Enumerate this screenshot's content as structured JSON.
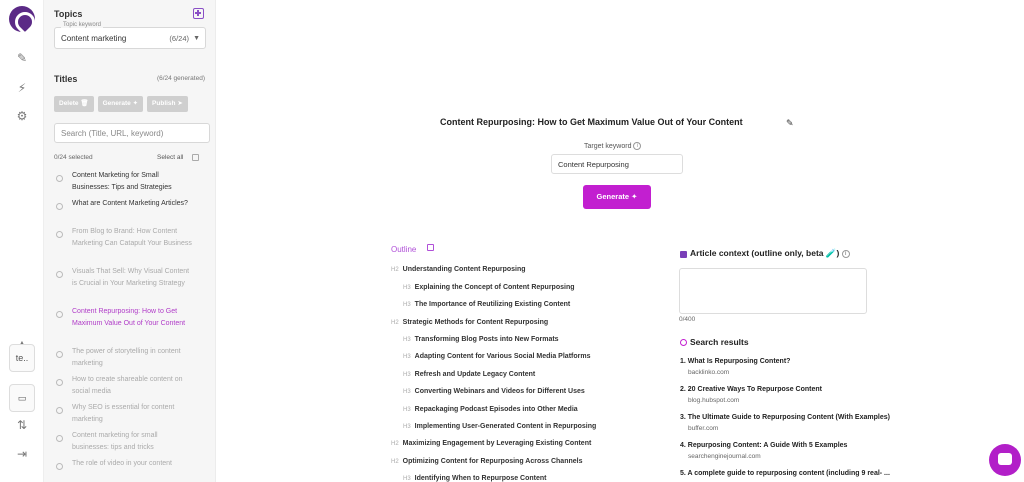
{
  "rail": {
    "workspace_label": "te.."
  },
  "topics": {
    "heading": "Topics",
    "keyword_label": "Topic keyword",
    "keyword_value": "Content marketing",
    "keyword_count": "(6/24)"
  },
  "titles": {
    "heading": "Titles",
    "generated": "(6/24 generated)",
    "delete_label": "Delete",
    "generate_label": "Generate",
    "publish_label": "Publish",
    "search_placeholder": "Search (Title, URL, keyword)",
    "selected": "0/24 selected",
    "select_all": "Select all",
    "items": [
      "Content Marketing for Small Businesses: Tips and Strategies",
      "What are Content Marketing Articles?",
      "From Blog to Brand: How Content Marketing Can Catapult Your Business",
      "Visuals That Sell: Why Visual Content is Crucial in Your Marketing Strategy",
      "Content Repurposing: How to Get Maximum Value Out of Your Content",
      "The power of storytelling in content marketing",
      "How to create shareable content on social media",
      "Why SEO is essential for content marketing",
      "Content marketing for small businesses: tips and tricks",
      "The role of video in your content"
    ]
  },
  "main": {
    "title": "Content Repurposing: How to Get Maximum Value Out of Your Content",
    "target_keyword_label": "Target keyword",
    "target_keyword_value": "Content Repurposing",
    "generate_label": "Generate"
  },
  "outline": {
    "heading": "Outline",
    "items": [
      {
        "level": "H2",
        "text": "Understanding Content Repurposing"
      },
      {
        "level": "H3",
        "text": "Explaining the Concept of Content Repurposing"
      },
      {
        "level": "H3",
        "text": "The Importance of Reutilizing Existing Content"
      },
      {
        "level": "H2",
        "text": "Strategic Methods for Content Repurposing"
      },
      {
        "level": "H3",
        "text": "Transforming Blog Posts into New Formats"
      },
      {
        "level": "H3",
        "text": "Adapting Content for Various Social Media Platforms"
      },
      {
        "level": "H3",
        "text": "Refresh and Update Legacy Content"
      },
      {
        "level": "H3",
        "text": "Converting Webinars and Videos for Different Uses"
      },
      {
        "level": "H3",
        "text": "Repackaging Podcast Episodes into Other Media"
      },
      {
        "level": "H3",
        "text": "Implementing User-Generated Content in Repurposing"
      },
      {
        "level": "H2",
        "text": "Maximizing Engagement by Leveraging Existing Content"
      },
      {
        "level": "H2",
        "text": "Optimizing Content for Repurposing Across Channels"
      },
      {
        "level": "H3",
        "text": "Identifying When to Repurpose Content"
      }
    ]
  },
  "context": {
    "heading": "Article context (outline only, beta 🧪)",
    "count": "0/400"
  },
  "search_results": {
    "heading": "Search results",
    "items": [
      {
        "title": "1. What Is Repurposing Content?",
        "url": "backlinko.com"
      },
      {
        "title": "2. 20 Creative Ways To Repurpose Content",
        "url": "blog.hubspot.com"
      },
      {
        "title": "3. The Ultimate Guide to Repurposing Content (With Examples)",
        "url": "buffer.com"
      },
      {
        "title": "4. Repurposing Content: A Guide With 5 Examples",
        "url": "searchenginejournal.com"
      },
      {
        "title": "5. A complete guide to repurposing content (including 9 real- ...",
        "url": ""
      }
    ]
  },
  "colors": {
    "accent": "#c21fd0",
    "brand": "#5b2a86"
  }
}
